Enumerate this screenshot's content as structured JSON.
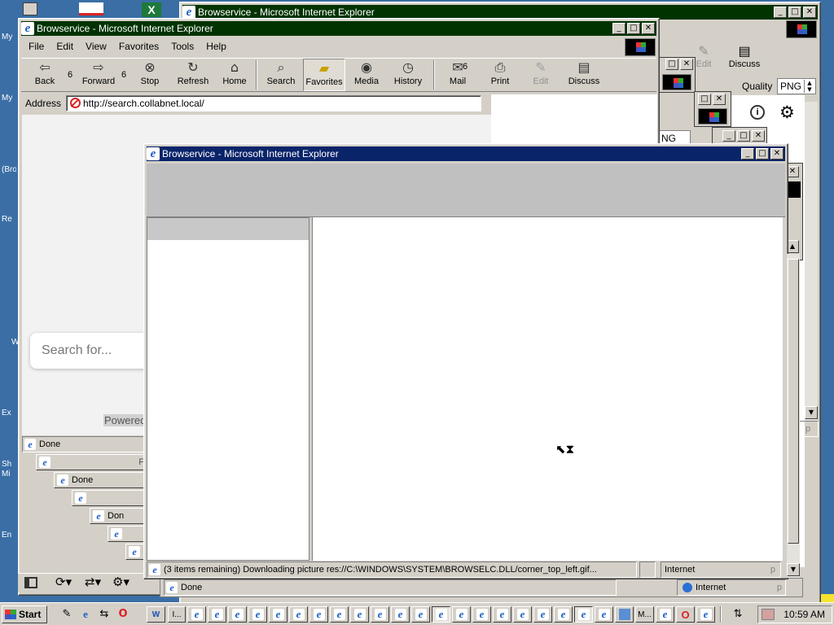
{
  "desktop": {
    "icon_labels": [
      "My",
      "My",
      "(Bro",
      "Re",
      "W",
      "Ex",
      "Sh",
      "Mi",
      "En"
    ]
  },
  "back_window": {
    "title": "Browservice - Microsoft Internet Explorer",
    "toolbar_visible": [
      "Edit",
      "Discuss"
    ],
    "quality_label": "Quality",
    "quality_value": "PNG",
    "quality_value_2": "NG",
    "status_right": "p"
  },
  "main_window": {
    "title": "Browservice - Microsoft Internet Explorer",
    "menu": [
      "File",
      "Edit",
      "View",
      "Favorites",
      "Tools",
      "Help"
    ],
    "toolbar": {
      "back": "Back",
      "back_count": "6",
      "forward": "Forward",
      "forward_count": "6",
      "stop": "Stop",
      "refresh": "Refresh",
      "home": "Home",
      "search": "Search",
      "favorites": "Favorites",
      "media": "Media",
      "history": "History",
      "mail": "Mail",
      "mail_count": "6",
      "print": "Print",
      "edit": "Edit",
      "discuss": "Discuss"
    },
    "address_label": "Address",
    "address_value": "http://search.collabnet.local/",
    "page": {
      "search_placeholder": "Search for...",
      "powered": "Powered"
    },
    "status": "Done"
  },
  "cascade": {
    "statuses": [
      "F",
      "Done",
      "Don"
    ]
  },
  "front_window": {
    "title": "Browservice - Microsoft Internet Explorer",
    "status": "(3 items remaining) Downloading picture res://C:\\WINDOWS\\SYSTEM\\BROWSELC.DLL/corner_top_left.gif...",
    "zone": "Internet",
    "status_right": "p"
  },
  "bottom_strip": {
    "status": "Done",
    "zone": "Internet",
    "status_right": "p"
  },
  "taskbar": {
    "start_label": "Start",
    "task_ie_label": "I...",
    "task_m_label": "M...",
    "clock": "10:59 AM"
  }
}
